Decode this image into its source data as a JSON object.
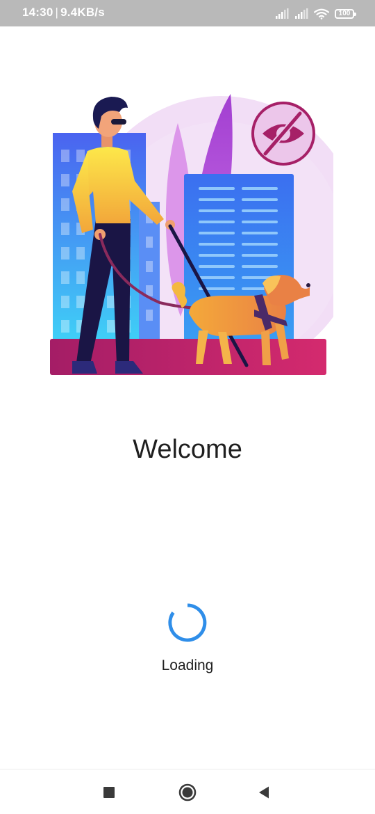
{
  "status_bar": {
    "time": "14:30",
    "speed": "9.4KB/s",
    "battery_level": "100",
    "icons": [
      "signal-icon",
      "signal-icon",
      "wifi-icon",
      "battery-icon"
    ]
  },
  "illustration": {
    "icon": "eye-slash-icon"
  },
  "main": {
    "title": "Welcome",
    "loading_label": "Loading"
  },
  "nav": {
    "icons": [
      "recents-square-icon",
      "home-circle-icon",
      "back-triangle-icon"
    ]
  },
  "colors": {
    "spinner": "#2f8ee9",
    "status_bar": "#b9b9b9"
  }
}
